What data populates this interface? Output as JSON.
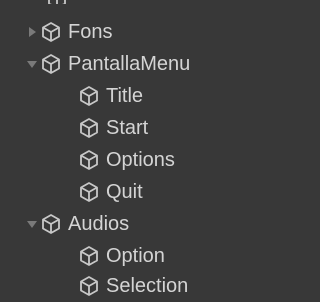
{
  "hierarchy": {
    "items": [
      {
        "label": "Fons",
        "expanded": false
      },
      {
        "label": "PantallaMenu",
        "expanded": true
      },
      {
        "label": "Title"
      },
      {
        "label": "Start"
      },
      {
        "label": "Options"
      },
      {
        "label": "Quit"
      },
      {
        "label": "Audios",
        "expanded": true
      },
      {
        "label": "Option"
      },
      {
        "label": "Selection"
      }
    ]
  },
  "icons": {
    "object": "gameobject-cube-icon",
    "collapsed": "arrow-right-icon",
    "expanded": "arrow-down-icon"
  },
  "colors": {
    "background": "#383838",
    "text": "#d4d4d4",
    "icon": "#c8c8c8",
    "arrow": "#7a7a7a"
  }
}
